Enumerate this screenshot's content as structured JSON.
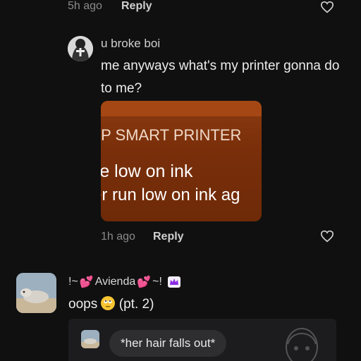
{
  "thread_top": {
    "time": "5h ago",
    "reply_label": "Reply"
  },
  "reply_comment": {
    "username": "u broke boi",
    "text": "me anyways what's my printer gonna do to me?",
    "image": {
      "line1": "IP SMART PRINTER",
      "line2": "re low on ink",
      "line3": "er run low on ink ag"
    },
    "time": "1h ago",
    "reply_label": "Reply"
  },
  "main_comment": {
    "username_prefix": "!~",
    "username_core": "Avienda",
    "username_suffix": "~!",
    "text_before": "oops",
    "text_after": "(pt. 2)",
    "nested_preview": {
      "text": "*her hair falls out*"
    }
  },
  "colors": {
    "background": "#101010",
    "ink_card": "#7a2f0a",
    "bubble": "#2e2e30",
    "heart_emoji": "#ff4f9a"
  }
}
